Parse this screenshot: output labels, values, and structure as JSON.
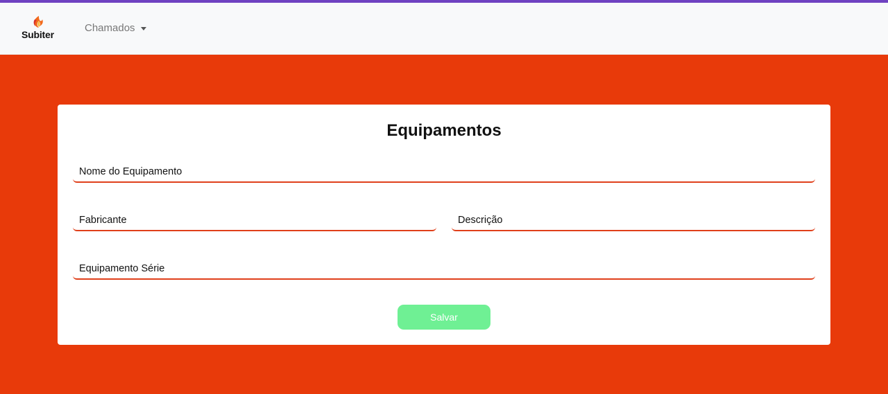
{
  "navbar": {
    "brand": "Subiter",
    "menu_label": "Chamados"
  },
  "form": {
    "title": "Equipamentos",
    "fields": {
      "nome_placeholder": "Nome do Equipamento",
      "fabricante_placeholder": "Fabricante",
      "descricao_placeholder": "Descrição",
      "serie_placeholder": "Equipamento Série"
    },
    "save_label": "Salvar"
  },
  "colors": {
    "background": "#e83a0a",
    "accent_line": "#6f42c1",
    "button": "#6ff094",
    "field_underline": "#e03f1a"
  },
  "icons": [
    "flame-logo-icon",
    "caret-down-icon"
  ]
}
